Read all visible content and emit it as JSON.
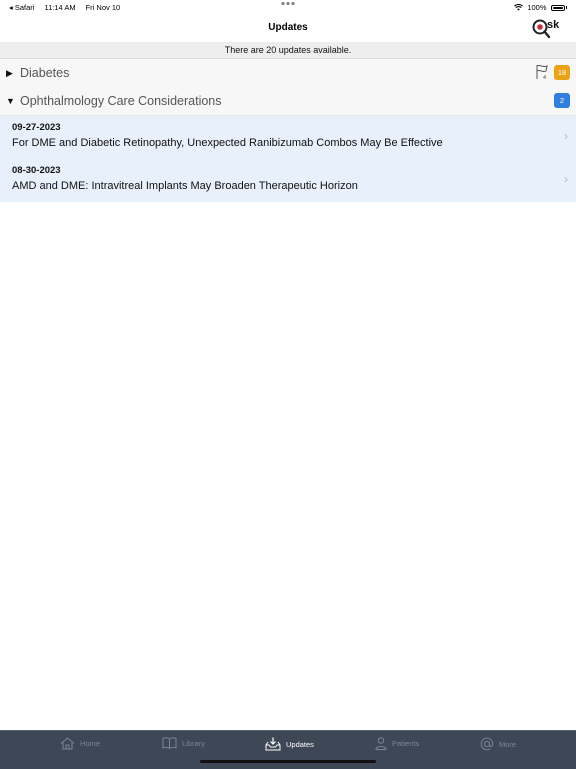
{
  "status_bar": {
    "back_app": "◂ Safari",
    "time": "11:14 AM",
    "date": "Fri Nov 10",
    "battery": "100%"
  },
  "nav": {
    "title": "Updates",
    "logo_text": "sk"
  },
  "banner": {
    "text": "There are 20 updates available."
  },
  "sections": [
    {
      "title": "Diabetes",
      "expanded": false,
      "flag_count": "4",
      "badge": "18",
      "badge_color": "#e8a317"
    },
    {
      "title": "Ophthalmology Care Considerations",
      "expanded": true,
      "badge": "2",
      "badge_color": "#2f7fdf",
      "items": [
        {
          "date": "09-27-2023",
          "title": "For DME and Diabetic Retinopathy, Unexpected Ranibizumab Combos May Be Effective"
        },
        {
          "date": "08-30-2023",
          "title": "AMD and DME: Intravitreal Implants May Broaden Therapeutic Horizon"
        }
      ]
    }
  ],
  "tabs": [
    {
      "label": "Home",
      "icon": "home-icon",
      "active": false
    },
    {
      "label": "Library",
      "icon": "book-icon",
      "active": false
    },
    {
      "label": "Updates",
      "icon": "inbox-download-icon",
      "active": true
    },
    {
      "label": "Patients",
      "icon": "person-icon",
      "active": false
    },
    {
      "label": "More",
      "icon": "at-icon",
      "active": false
    }
  ],
  "colors": {
    "tab_bar": "#3d4756",
    "row_background": "#e8f0fb",
    "logo_red": "#d22b3a"
  }
}
